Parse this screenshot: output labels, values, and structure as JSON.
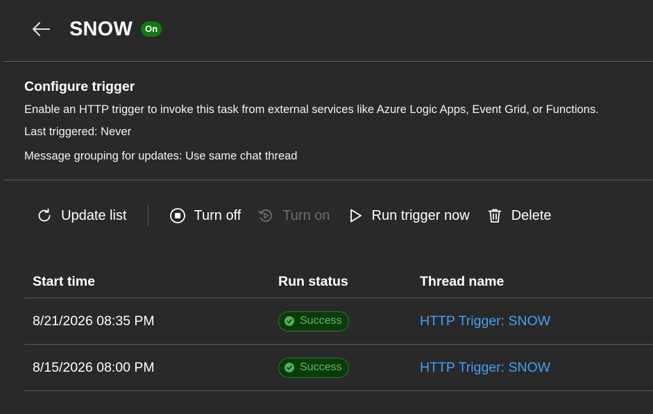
{
  "header": {
    "back_icon": "arrow-left-icon",
    "title": "SNOW",
    "state_badge": "On",
    "badge_color": "#107c10"
  },
  "config": {
    "heading": "Configure trigger",
    "description": "Enable an HTTP trigger to invoke this task from external services like Azure Logic Apps, Event Grid, or Functions.",
    "last_triggered": "Last triggered: Never",
    "message_grouping": "Message grouping for updates: Use same chat thread"
  },
  "toolbar": {
    "update_list": {
      "label": "Update list",
      "icon": "refresh-icon",
      "enabled": true
    },
    "turn_off": {
      "label": "Turn off",
      "icon": "stop-circle-icon",
      "enabled": true
    },
    "turn_on": {
      "label": "Turn on",
      "icon": "play-circle-icon",
      "enabled": false
    },
    "run_trigger_now": {
      "label": "Run trigger now",
      "icon": "play-icon",
      "enabled": true
    },
    "delete": {
      "label": "Delete",
      "icon": "trash-icon",
      "enabled": true
    }
  },
  "table": {
    "columns": [
      "Start time",
      "Run status",
      "Thread name"
    ],
    "rows": [
      {
        "start_time": "8/21/2026 08:35 PM",
        "status": "Success",
        "thread": "HTTP Trigger: SNOW"
      },
      {
        "start_time": "8/15/2026 08:00 PM",
        "status": "Success",
        "thread": "HTTP Trigger: SNOW"
      }
    ]
  },
  "colors": {
    "background": "#292929",
    "link": "#479ef5",
    "success": "#5dc35d"
  }
}
